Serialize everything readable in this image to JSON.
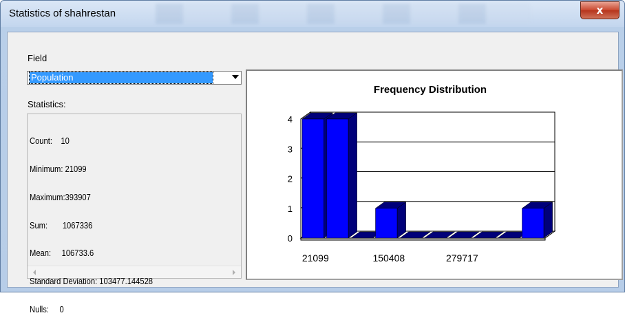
{
  "window": {
    "title": "Statistics of shahrestan",
    "close_glyph": "x"
  },
  "field": {
    "label": "Field",
    "selected": "Population"
  },
  "statistics": {
    "label": "Statistics:",
    "lines": [
      "Count:    10",
      "Minimum: 21099",
      "Maximum:393907",
      "Sum:       1067336",
      "Mean:     106733.6",
      "Standard Deviation: 103477.144528",
      "Nulls:     0"
    ]
  },
  "chart_data": {
    "type": "bar",
    "title": "Frequency Distribution",
    "values": [
      4,
      4,
      0,
      1,
      0,
      0,
      0,
      0,
      0,
      1
    ],
    "yticks": [
      "0",
      "1",
      "2",
      "3",
      "4"
    ],
    "ylim": [
      0,
      4
    ],
    "xtick_labels": [
      "21099",
      "150408",
      "279717"
    ],
    "bar_color": "#0000ff",
    "bar_side_color": "#00007a"
  }
}
